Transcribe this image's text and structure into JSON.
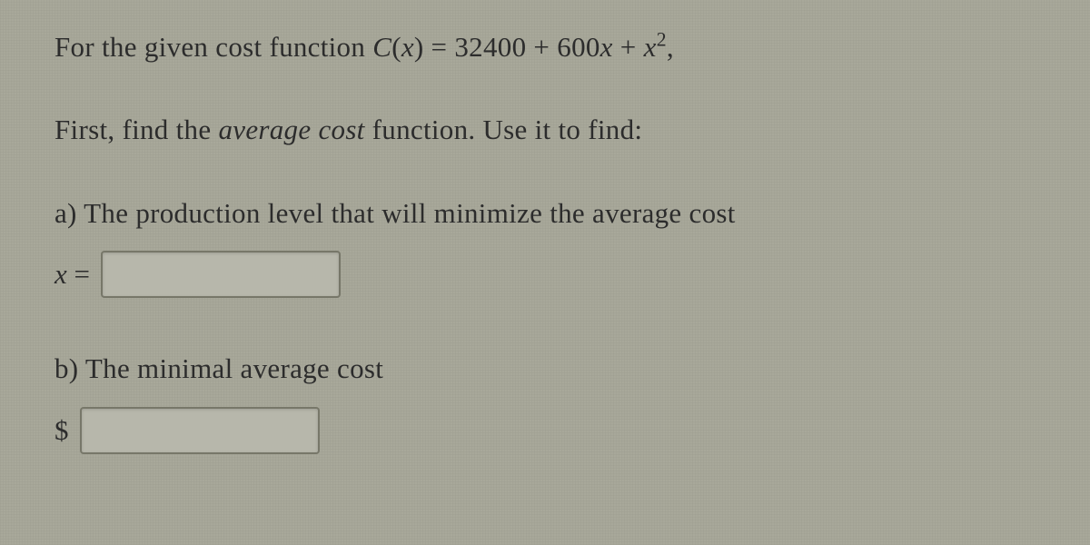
{
  "problem": {
    "intro_prefix": "For the given cost function ",
    "func_name": "C",
    "func_arg": "x",
    "eq_rhs_part1": " = 32400 + 600",
    "eq_rhs_var": "x",
    "eq_rhs_part2": " + ",
    "eq_rhs_var2": "x",
    "eq_rhs_exp": "2",
    "eq_rhs_tail": ",",
    "instruction_prefix": "First, find the ",
    "instruction_emph": "average cost",
    "instruction_suffix": " function. Use it to find:",
    "part_a": {
      "label": "a) The production level that will minimize the average cost",
      "var": "x",
      "equals": " ="
    },
    "part_b": {
      "label": "b) The minimal average cost",
      "currency": "$"
    }
  }
}
